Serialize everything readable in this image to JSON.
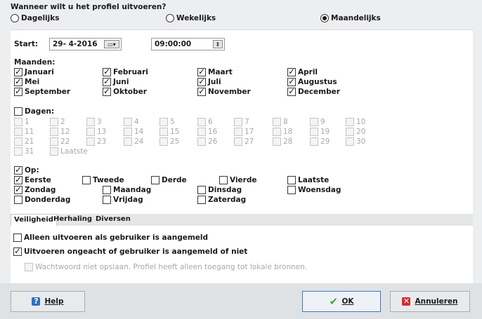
{
  "question": "Wanneer wilt u het profiel uitvoeren?",
  "frequency": {
    "options": [
      "Dagelijks",
      "Wekelijks",
      "Maandelijks"
    ],
    "selected": "Maandelijks"
  },
  "start": {
    "label": "Start:",
    "date": "29- 4-2016",
    "time": "09:00:00"
  },
  "months": {
    "label": "Maanden:",
    "items": [
      "Januari",
      "Februari",
      "Maart",
      "April",
      "Mei",
      "Juni",
      "Juli",
      "Augustus",
      "September",
      "Oktober",
      "November",
      "December"
    ]
  },
  "days": {
    "label": "Dagen:",
    "items": [
      "1",
      "2",
      "3",
      "4",
      "5",
      "6",
      "7",
      "8",
      "9",
      "10",
      "11",
      "12",
      "13",
      "14",
      "15",
      "16",
      "17",
      "18",
      "19",
      "20",
      "21",
      "22",
      "23",
      "24",
      "25",
      "26",
      "27",
      "28",
      "29",
      "30",
      "31",
      "Laatste"
    ]
  },
  "on": {
    "label": "Op:",
    "ordinals": [
      "Eerste",
      "Tweede",
      "Derde",
      "Vierde",
      "Laatste"
    ],
    "weekdays": [
      "Woensdag",
      "Zondag",
      "Maandag",
      "Dinsdag",
      "Donderdag",
      "Vrijdag",
      "Zaterdag"
    ]
  },
  "tabs": [
    "Veiligheid",
    "Herhaling",
    "Diversen"
  ],
  "security": {
    "opt1": "Alleen uitvoeren als gebruiker is aangemeld",
    "opt2": "Uitvoeren ongeacht of gebruiker is aangemeld of niet",
    "opt3": "Wachtwoord niet opslaan. Profiel heeft alleen toegang tot lokale bronnen."
  },
  "buttons": {
    "help": "Help",
    "ok": "OK",
    "cancel": "Annuleren"
  },
  "colors": {
    "ok_check": "#3cab3c",
    "help_icon": "#2d6fc1",
    "cancel_icon": "#d32f2f"
  }
}
